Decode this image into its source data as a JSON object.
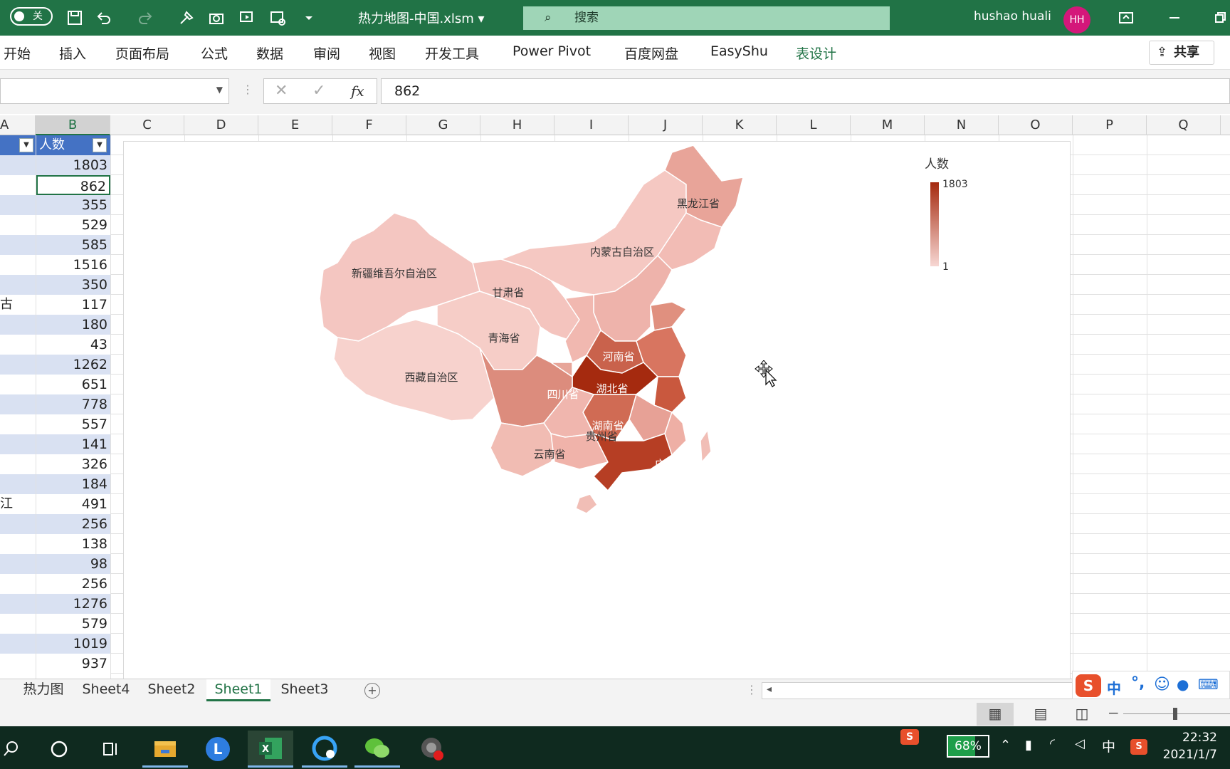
{
  "titlebar": {
    "autosave_label": "关",
    "filename": "热力地图-中国.xlsm",
    "search_placeholder": "搜索",
    "user": "hushao huali",
    "avatar": "HH"
  },
  "ribbon": {
    "tabs": [
      "开始",
      "插入",
      "页面布局",
      "公式",
      "数据",
      "审阅",
      "视图",
      "开发工具",
      "Power Pivot",
      "百度网盘",
      "EasyShu",
      "表设计"
    ],
    "share": "共享"
  },
  "formula_bar": {
    "fx": "fx",
    "value": "862"
  },
  "columns": [
    "A",
    "B",
    "C",
    "D",
    "E",
    "F",
    "G",
    "H",
    "I",
    "J",
    "K",
    "L",
    "M",
    "N",
    "O",
    "P",
    "Q"
  ],
  "table": {
    "header_b": "人数",
    "values": [
      "1803",
      "862",
      "355",
      "529",
      "585",
      "1516",
      "350",
      "117",
      "180",
      "43",
      "1262",
      "651",
      "778",
      "557",
      "141",
      "326",
      "184",
      "491",
      "256",
      "138",
      "98",
      "256",
      "1276",
      "579",
      "1019",
      "937"
    ],
    "col_a_fragments": {
      "7": "古",
      "17": "江"
    }
  },
  "chart": {
    "legend_title": "人数",
    "legend_max": "1803",
    "legend_min": "1",
    "scale_colors": [
      "#f7d7d3",
      "#a52a0f"
    ],
    "labels": [
      "黑龙江省",
      "内蒙古自治区",
      "新疆维吾尔自治区",
      "甘肃省",
      "青海省",
      "西藏自治区",
      "河南省",
      "湖北省",
      "四川省",
      "湖南省",
      "贵州省",
      "云南省",
      "广东省"
    ]
  },
  "chart_data": {
    "type": "heatmap",
    "title": "",
    "legend": {
      "title": "人数",
      "min": 1,
      "max": 1803,
      "placement": "top-right"
    },
    "labeled_regions": [
      "黑龙江省",
      "内蒙古自治区",
      "新疆维吾尔自治区",
      "甘肃省",
      "青海省",
      "西藏自治区",
      "河南省",
      "湖北省",
      "四川省",
      "湖南省",
      "贵州省",
      "云南省",
      "广东省"
    ]
  },
  "sheets": [
    "热力图",
    "Sheet4",
    "Sheet2",
    "Sheet1",
    "Sheet3"
  ],
  "active_sheet": "Sheet1",
  "taskbar": {
    "battery": "68%",
    "ime": "中",
    "time": "22:32",
    "date": "2021/1/7"
  }
}
